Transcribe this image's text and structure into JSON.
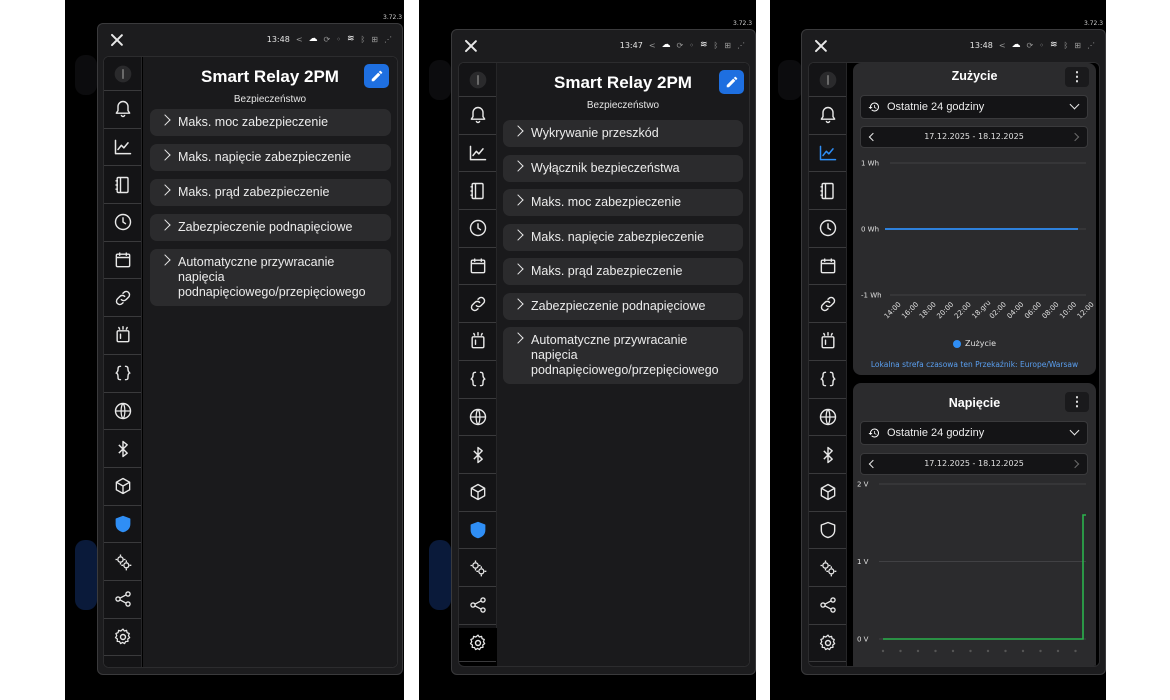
{
  "app_version": "3.72.3",
  "colors": {
    "accent": "#1e6fe0",
    "selected_icon": "#2f8ef5",
    "series_consumption": "#2f8ef5",
    "series_voltage": "#2bb24c"
  },
  "sidebar_icons": [
    "device-icon",
    "bell-icon",
    "chart-icon",
    "list-icon",
    "clock-icon",
    "calendar-icon",
    "link-icon",
    "script-icon",
    "code-icon",
    "globe-icon",
    "bluetooth-icon",
    "cube-icon",
    "shield-icon",
    "gears-icon",
    "share-icon",
    "settings-icon"
  ],
  "screens": [
    {
      "time": "13:48",
      "title": "Smart Relay 2PM",
      "subtitle": "Bezpieczeństwo",
      "selected_icon": "shield-icon",
      "menu": [
        "Maks. moc zabezpieczenie",
        "Maks. napięcie zabezpieczenie",
        "Maks. prąd zabezpieczenie",
        "Zabezpieczenie podnapięciowe",
        "Automatyczne przywracanie napięcia podnapięciowego/przepięciowego"
      ]
    },
    {
      "time": "13:47",
      "title": "Smart Relay 2PM",
      "subtitle": "Bezpieczeństwo",
      "selected_icon": "shield-icon",
      "menu": [
        "Wykrywanie przeszkód",
        "Wyłącznik bezpieczeństwa",
        "Maks. moc zabezpieczenie",
        "Maks. napięcie zabezpieczenie",
        "Maks. prąd zabezpieczenie",
        "Zabezpieczenie podnapięciowe",
        "Automatyczne przywracanie napięcia podnapięciowego/przepięciowego"
      ]
    },
    {
      "time": "13:48",
      "selected_icon": "chart-icon",
      "cards": [
        {
          "title": "Zużycie",
          "period": "Ostatnie 24 godziny",
          "range": "17.12.2025 - 18.12.2025",
          "legend": "Zużycie",
          "timezone_note": "Lokalna strefa czasowa ten Przekaźnik: Europe/Warsaw"
        },
        {
          "title": "Napięcie",
          "period": "Ostatnie 24 godziny",
          "range": "17.12.2025 - 18.12.2025"
        }
      ]
    }
  ],
  "chart_data": [
    {
      "type": "line",
      "title": "Zużycie",
      "x": [
        "14:00",
        "16:00",
        "18:00",
        "20:00",
        "22:00",
        "18.gru",
        "02:00",
        "04:00",
        "06:00",
        "08:00",
        "10:00",
        "12:00"
      ],
      "yticks": [
        "1 Wh",
        "0 Wh",
        "-1 Wh"
      ],
      "ylim": [
        -1,
        1
      ],
      "series": [
        {
          "name": "Zużycie",
          "values": [
            0,
            0,
            0,
            0,
            0,
            0,
            0,
            0,
            0,
            0,
            0,
            0
          ]
        }
      ],
      "legend": "bottom"
    },
    {
      "type": "line",
      "title": "Napięcie",
      "yticks": [
        "2 V",
        "1 V",
        "0 V"
      ],
      "ylim": [
        0,
        2
      ],
      "series": [
        {
          "values": [
            0,
            0,
            0,
            0,
            0,
            0,
            0,
            0,
            0,
            0,
            0,
            1.6
          ]
        }
      ]
    }
  ]
}
